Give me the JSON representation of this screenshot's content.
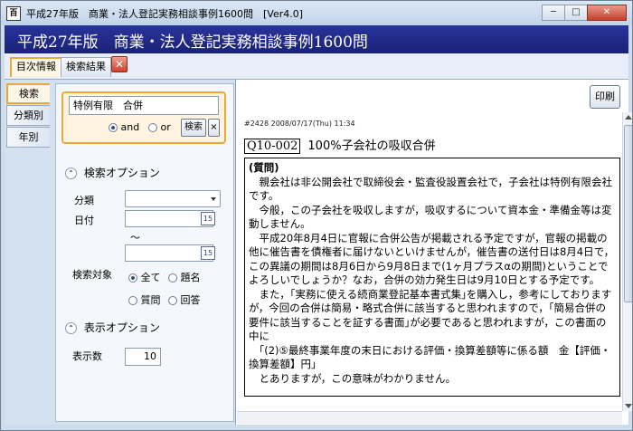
{
  "window": {
    "title": "平成27年版　商業・法人登記実務相談事例1600問　[Ver4.0]",
    "icon": "app-icon",
    "controls": [
      "minimize",
      "maximize",
      "close"
    ]
  },
  "banner": {
    "title": "平成27年版　商業・法人登記実務相談事例1600問"
  },
  "tabs": [
    {
      "label": "目次情報",
      "active": true
    },
    {
      "label": "検索結果",
      "active": false
    }
  ],
  "vtabs": [
    {
      "label": "検索",
      "active": true
    },
    {
      "label": "分類別",
      "active": false
    },
    {
      "label": "年別",
      "active": false
    }
  ],
  "search": {
    "query": "特例有限　合併",
    "mode_and": "and",
    "mode_or": "or",
    "mode_selected": "and",
    "search_button": "検索",
    "clear_button": "×"
  },
  "options": {
    "header": "検索オプション",
    "category_label": "分類",
    "category_value": "",
    "date_label": "日付",
    "date_from": "",
    "date_tilde": "～",
    "date_to": "",
    "calendar_label": "15",
    "target_label": "検索対象",
    "targets": [
      "全て",
      "題名",
      "質問",
      "回答"
    ],
    "target_selected": "全て"
  },
  "display": {
    "header": "表示オプション",
    "count_label": "表示数",
    "count_value": "10"
  },
  "content": {
    "print_button": "印刷",
    "meta": "#2428 2008/07/17(Thu) 11:34",
    "qid": "Q10-002",
    "qtitle": "100%子会社の吸収合併",
    "body_head": "(質問)",
    "paragraphs": [
      "　親会社は非公開会社で取締役会・監査役設置会社で，子会社は特例有限会社です。",
      "　今般，この子会社を吸収しますが，吸収するについて資本金・準備金等は変動しません。",
      "　平成20年8月4日に官報に合併公告が掲載される予定ですが，官報の掲載の他に催告書を債権者に届けないといけませんが，催告書の送付日は8月4日で，この異議の期間は8月6日から9月8日まで(1ヶ月プラスαの期間)ということでよろしいでしょうか？なお，合併の効力発生日は9月10日とする予定です。",
      "　また，｢実務に使える続商業登記基本書式集｣を購入し，参考にしておりますが，今回の合併は簡易・略式合併に該当すると思われますので，｢簡易合併の要件に該当することを証する書面｣が必要であると思われますが，この書面の中に",
      "　｢(2)⑤最終事業年度の末日における評価・換算差額等に係る額　金【評価・換算差額】円｣",
      "　とありますが，この意味がわかりません。"
    ]
  }
}
